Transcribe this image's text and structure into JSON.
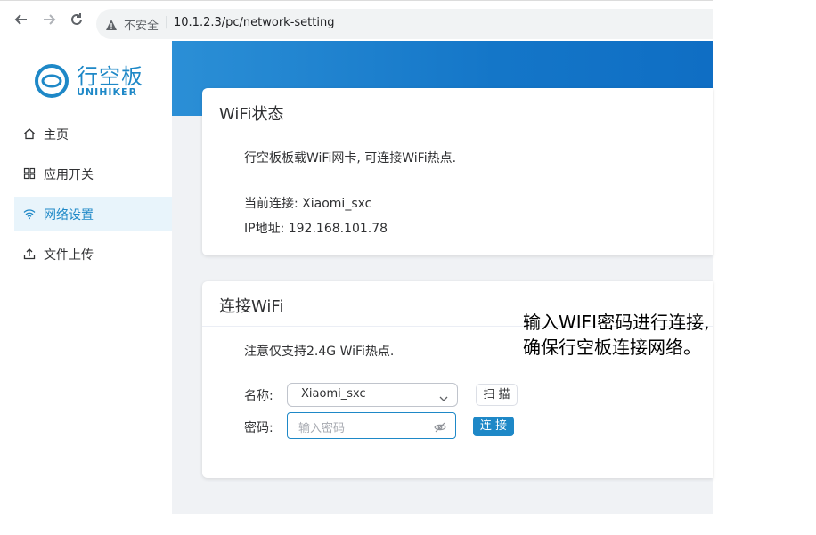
{
  "browser": {
    "security_label": "不安全",
    "separator": "|",
    "url": "10.1.2.3/pc/network-setting"
  },
  "logo": {
    "title": "行空板",
    "subtitle": "UNIHIKER"
  },
  "sidebar": {
    "items": [
      {
        "label": "主页",
        "icon": "home-icon",
        "active": false
      },
      {
        "label": "应用开关",
        "icon": "grid-icon",
        "active": false
      },
      {
        "label": "网络设置",
        "icon": "wifi-icon",
        "active": true
      },
      {
        "label": "文件上传",
        "icon": "upload-icon",
        "active": false
      }
    ]
  },
  "wifi_status": {
    "title": "WiFi状态",
    "description": "行空板板载WiFi网卡, 可连接WiFi热点.",
    "current_connection": "当前连接: Xiaomi_sxc",
    "ip_address": "IP地址: 192.168.101.78"
  },
  "connect_wifi": {
    "title": "连接WiFi",
    "note": "注意仅支持2.4G WiFi热点.",
    "name_label": "名称:",
    "selected_ssid": "Xiaomi_sxc",
    "scan_button": "扫 描",
    "password_label": "密码:",
    "password_placeholder": "输入密码",
    "connect_button": "连 接"
  },
  "annotation": {
    "line1": "输入WIFI密码进行连接,",
    "line2": "确保行空板连接网络。"
  },
  "colors": {
    "accent": "#1e88c7",
    "banner": "#1476c8",
    "background": "#f0f2f5"
  }
}
